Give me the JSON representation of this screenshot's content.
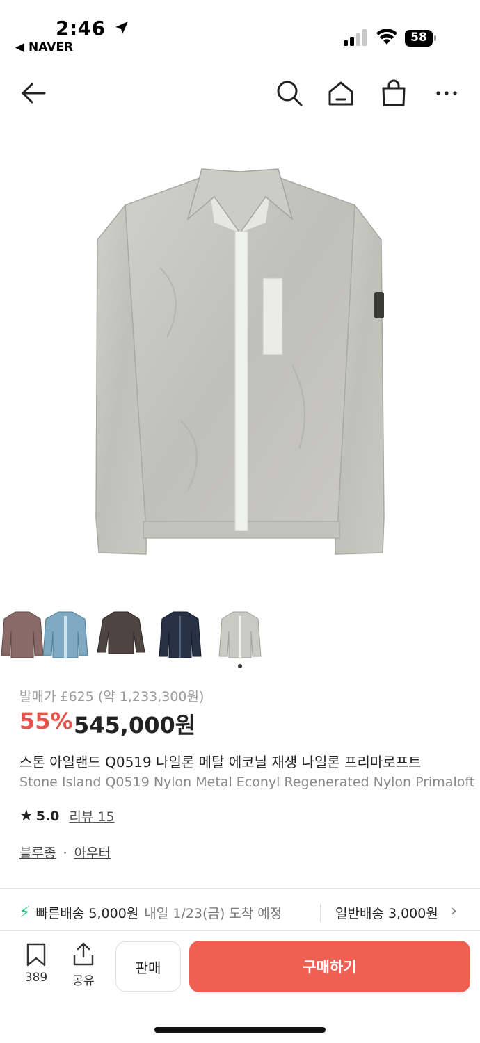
{
  "status_bar": {
    "time": "2:46",
    "back_app": "NAVER",
    "battery": "58"
  },
  "nav": {
    "icons": [
      "back-arrow-icon",
      "search-icon",
      "home-icon",
      "shopping-bag-icon",
      "more-icon"
    ]
  },
  "product": {
    "thumbnails": [
      "brown-jacket",
      "blue-jacket",
      "dark-brown-jacket",
      "navy-jacket",
      "grey-jacket"
    ],
    "selected_thumbnail_index": 4,
    "original_price": "발매가 £625 (약 1,233,300원)",
    "discount": "55%",
    "price": "545,000원",
    "title_ko": "스톤 아일랜드 Q0519 나일론 메탈 에코닐 재생 나일론 프리마로프트",
    "title_en": "Stone Island Q0519 Nylon Metal Econyl Regenerated Nylon Primaloft",
    "rating": "5.0",
    "review_label": "리뷰 15",
    "category_1": "블루종",
    "category_sep": "·",
    "category_2": "아우터"
  },
  "shipping": {
    "fast_label": "빠른배송 5,000원",
    "fast_eta": "내일 1/23(금) 도착 예정",
    "normal_label": "일반배송 3,000원"
  },
  "bottom_bar": {
    "save_count": "389",
    "share_label": "공유",
    "sell_label": "판매",
    "buy_label": "구매하기"
  },
  "colors": {
    "accent": "#ef5f52",
    "discount": "#e8524a",
    "fast_ship": "#1dbf73"
  }
}
